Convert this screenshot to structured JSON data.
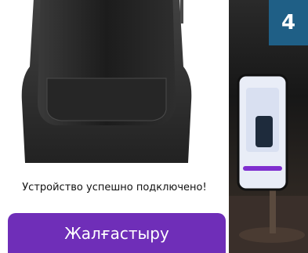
{
  "status": {
    "message": "Устройство успешно подключено!"
  },
  "actions": {
    "continue_label": "Жалғастыру"
  },
  "badge": {
    "step": "4"
  },
  "colors": {
    "accent": "#6f2eb8",
    "badge": "#1f5f86"
  }
}
